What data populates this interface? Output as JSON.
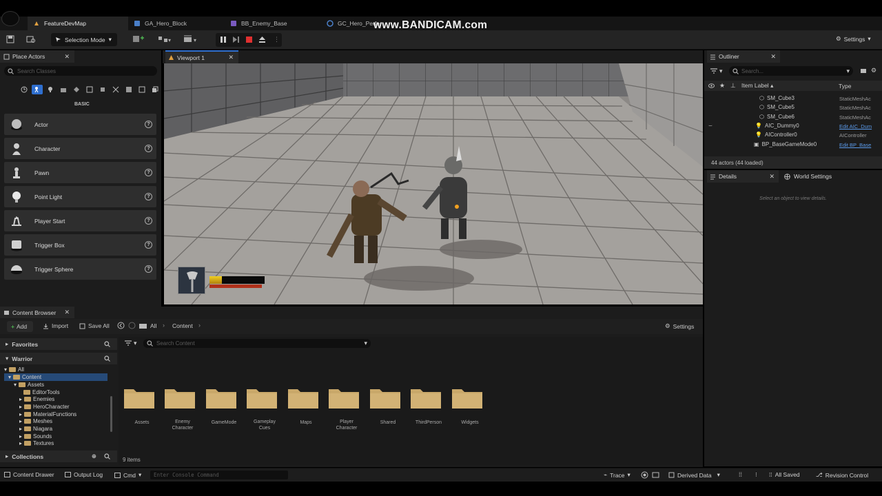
{
  "watermark": "www.BANDICAM.com",
  "tabs": [
    {
      "label": "FeatureDevMap",
      "active": true
    },
    {
      "label": "GA_Hero_Block",
      "active": false
    },
    {
      "label": "BB_Enemy_Base",
      "active": false
    },
    {
      "label": "GC_Hero_Perfe",
      "active": false
    }
  ],
  "toolbar": {
    "selection_mode": "Selection Mode",
    "settings": "Settings"
  },
  "place_actors": {
    "title": "Place Actors",
    "search_placeholder": "Search Classes",
    "category": "BASIC",
    "items": [
      "Actor",
      "Character",
      "Pawn",
      "Point Light",
      "Player Start",
      "Trigger Box",
      "Trigger Sphere"
    ]
  },
  "viewport": {
    "title": "Viewport 1"
  },
  "outliner": {
    "title": "Outliner",
    "search_placeholder": "Search...",
    "col_label": "Item Label",
    "col_type": "Type",
    "rows": [
      {
        "label": "SM_Cube3",
        "type": "StaticMeshAc"
      },
      {
        "label": "SM_Cube5",
        "type": "StaticMeshAc"
      },
      {
        "label": "SM_Cube6",
        "type": "StaticMeshAc"
      },
      {
        "label": "AIC_Dummy0",
        "type": "Edit AIC_Dum"
      },
      {
        "label": "AIController0",
        "type": "AIController"
      },
      {
        "label": "BP_BaseGameMode0",
        "type": "Edit BP_Base"
      }
    ],
    "footer": "44 actors (44 loaded)"
  },
  "details": {
    "title": "Details",
    "world_settings": "World Settings",
    "empty_msg": "Select an object to view details."
  },
  "content_browser": {
    "title": "Content Browser",
    "add": "Add",
    "import": "Import",
    "save_all": "Save All",
    "path": [
      "All",
      "Content"
    ],
    "settings": "Settings",
    "search_placeholder": "Search Content",
    "favorites": "Favorites",
    "project": "Warrior",
    "tree": [
      "All",
      "Content",
      "Assets",
      "EditorTools",
      "Enemies",
      "HeroCharacter",
      "MaterialFunctions",
      "Meshes",
      "Niagara",
      "Sounds",
      "Textures"
    ],
    "collections": "Collections",
    "folders": [
      "Assets",
      "Enemy\nCharacter",
      "GameMode",
      "Gameplay\nCues",
      "Maps",
      "Player\nCharacter",
      "Shared",
      "ThirdPerson",
      "Widgets"
    ],
    "count": "9 items"
  },
  "status_bar": {
    "content_drawer": "Content Drawer",
    "output_log": "Output Log",
    "cmd": "Cmd",
    "console_placeholder": "Enter Console Command",
    "trace": "Trace",
    "derived_data": "Derived Data",
    "all_saved": "All Saved",
    "revision_control": "Revision Control"
  },
  "hud": {
    "health_fraction": 0.22
  }
}
